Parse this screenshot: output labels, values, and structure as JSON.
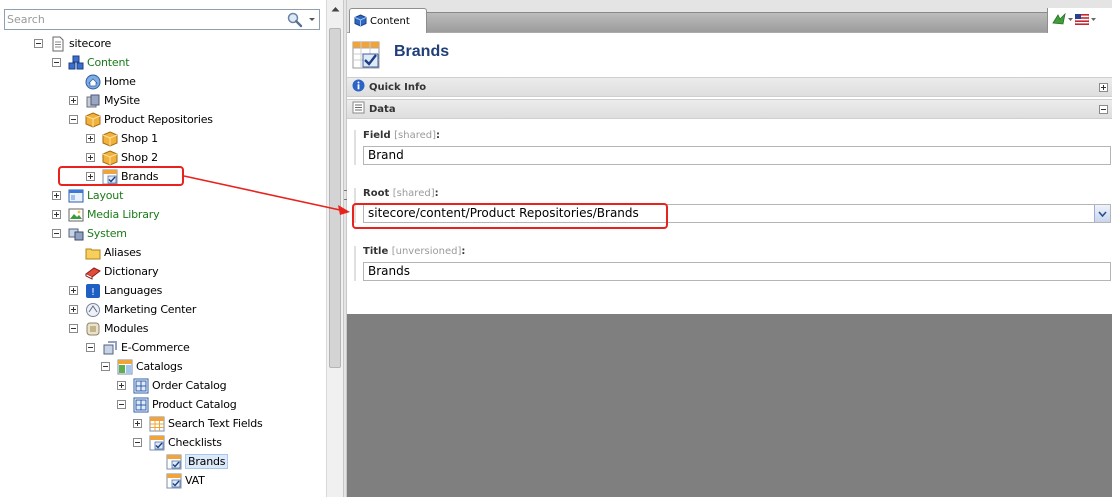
{
  "search": {
    "placeholder": "Search"
  },
  "tree": {
    "items": [
      {
        "label": "sitecore",
        "icon": "document-icon"
      },
      {
        "label": "Content",
        "icon": "content-icon",
        "color": "#1a7a1a"
      },
      {
        "label": "Home",
        "icon": "home-icon"
      },
      {
        "label": "MySite",
        "icon": "site-icon"
      },
      {
        "label": "Product Repositories",
        "icon": "box-icon"
      },
      {
        "label": "Shop 1",
        "icon": "box-icon"
      },
      {
        "label": "Shop 2",
        "icon": "box-icon"
      },
      {
        "label": "Brands",
        "icon": "checklist-icon"
      },
      {
        "label": "Layout",
        "icon": "layout-icon",
        "color": "#1a7a1a"
      },
      {
        "label": "Media Library",
        "icon": "media-icon",
        "color": "#1a7a1a"
      },
      {
        "label": "System",
        "icon": "system-icon",
        "color": "#1a7a1a"
      },
      {
        "label": "Aliases",
        "icon": "folder-icon"
      },
      {
        "label": "Dictionary",
        "icon": "book-icon"
      },
      {
        "label": "Languages",
        "icon": "flag-icon"
      },
      {
        "label": "Marketing Center",
        "icon": "marketing-icon"
      },
      {
        "label": "Modules",
        "icon": "module-icon"
      },
      {
        "label": "E-Commerce",
        "icon": "ecommerce-icon"
      },
      {
        "label": "Catalogs",
        "icon": "catalog-icon"
      },
      {
        "label": "Order Catalog",
        "icon": "grid-icon"
      },
      {
        "label": "Product Catalog",
        "icon": "grid-icon"
      },
      {
        "label": "Search Text Fields",
        "icon": "table-icon"
      },
      {
        "label": "Checklists",
        "icon": "checklist-icon"
      },
      {
        "label": "Brands",
        "icon": "checklist-icon",
        "selected": true
      },
      {
        "label": "VAT",
        "icon": "checklist-icon"
      }
    ]
  },
  "tabs": {
    "content_label": "Content"
  },
  "item": {
    "title": "Brands",
    "icon": "checklist-icon"
  },
  "sections": {
    "quick_info": "Quick Info",
    "data": "Data"
  },
  "fields": {
    "field": {
      "label": "Field",
      "meta": "[shared]",
      "value": "Brand"
    },
    "root": {
      "label": "Root",
      "meta": "[shared]",
      "value": "sitecore/content/Product Repositories/Brands"
    },
    "title": {
      "label": "Title",
      "meta": "[unversioned]",
      "value": "Brands"
    }
  },
  "colors": {
    "accent": "#1f3f76",
    "annotation": "#e8221d",
    "node_green": "#1a7a1a"
  }
}
